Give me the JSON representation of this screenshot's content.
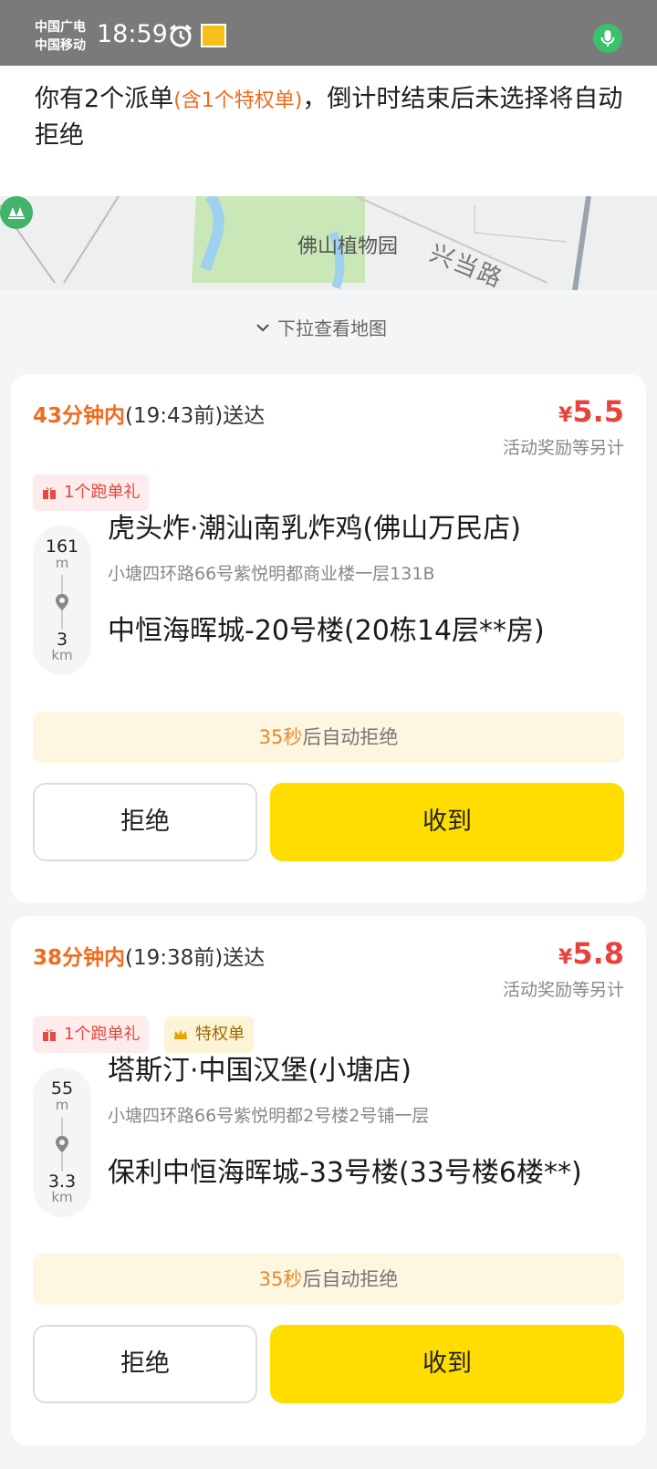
{
  "status": {
    "carrier1": "中国广电",
    "carrier2": "中国移动",
    "time": "18:59"
  },
  "notice": {
    "pre": "你有2个派单",
    "highlight": "(含1个特权单)",
    "post": "，倒计时结束后未选择将自动拒绝"
  },
  "map": {
    "poi": "佛山植物园",
    "road": "兴当路"
  },
  "pull_hint": "下拉查看地图",
  "orders": [
    {
      "eta_mins": "43分钟内",
      "eta_rest": "(19:43前)送达",
      "currency": "¥",
      "price": "5.5",
      "price_note": "活动奖励等另计",
      "tag_gift": "1个跑单礼",
      "dist1": "161",
      "unit1": "m",
      "dist2": "3",
      "unit2": "km",
      "shop": "虎头炸·潮汕南乳炸鸡(佛山万民店)",
      "shop_addr": "小塘四环路66号紫悦明都商业楼一层131B",
      "dest": "中恒海晖城-20号楼(20栋14层**房)",
      "countdown_sec": "35秒",
      "countdown_rest": "后自动拒绝",
      "reject": "拒绝",
      "accept": "收到"
    },
    {
      "eta_mins": "38分钟内",
      "eta_rest": "(19:38前)送达",
      "currency": "¥",
      "price": "5.8",
      "price_note": "活动奖励等另计",
      "tag_gift": "1个跑单礼",
      "tag_vip": "特权单",
      "dist1": "55",
      "unit1": "m",
      "dist2": "3.3",
      "unit2": "km",
      "shop": "塔斯汀·中国汉堡(小塘店)",
      "shop_addr": "小塘四环路66号紫悦明都2号楼2号铺一层",
      "dest": "保利中恒海晖城-33号楼(33号楼6楼**)",
      "countdown_sec": "35秒",
      "countdown_rest": "后自动拒绝",
      "reject": "拒绝",
      "accept": "收到"
    }
  ],
  "colors": {
    "accent_orange": "#f06b1c",
    "price_red": "#e8433b",
    "accept_yellow": "#ffdd00"
  }
}
